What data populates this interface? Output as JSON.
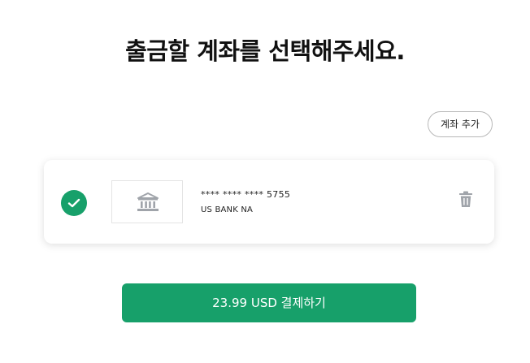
{
  "header": {
    "title": "출금할 계좌를 선택해주세요."
  },
  "actions": {
    "add_account_label": "계좌 추가"
  },
  "account": {
    "selected": true,
    "number_masked": "**** **** **** 5755",
    "bank_name": "US BANK NA",
    "logo_icon": "bank-building-icon",
    "delete_icon": "trash-icon"
  },
  "payment": {
    "button_label": "23.99 USD 결제하기"
  },
  "colors": {
    "accent": "#17a06a",
    "icon_gray": "#a0a4aa"
  }
}
